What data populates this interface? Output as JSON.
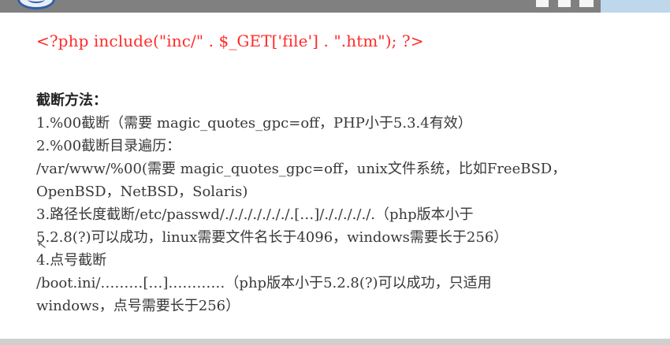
{
  "slide": {
    "code": "<?php include(\"inc/\" . $_GET['file'] . \".htm\"); ?>",
    "title": "截断方法：",
    "lines": [
      "1.%00截断（需要 magic_quotes_gpc=off，PHP小于5.3.4有效）",
      "2.%00截断目录遍历：",
      "/var/www/%00(需要 magic_quotes_gpc=off，unix文件系统，比如FreeBSD，",
      "OpenBSD，NetBSD，Solaris)",
      "3.路径长度截断/etc/passwd/./././././././.[…]/./././././.（php版本小于",
      "5.2.8(?)可以成功，linux需要文件名长于4096，windows需要长于256）",
      "4.点号截断",
      "/boot.ini/………[…]…………（php版本小于5.2.8(?)可以成功，只适用",
      "windows，点号需要长于256）"
    ]
  },
  "ui": {
    "cursor_icon": "mouse-pointer-icon",
    "logo_icon": "logo-icon"
  },
  "colors": {
    "code_text": "#ff2a2a",
    "body_text": "#383838",
    "top_bar": "#808080",
    "accent": "#bed7ea"
  }
}
